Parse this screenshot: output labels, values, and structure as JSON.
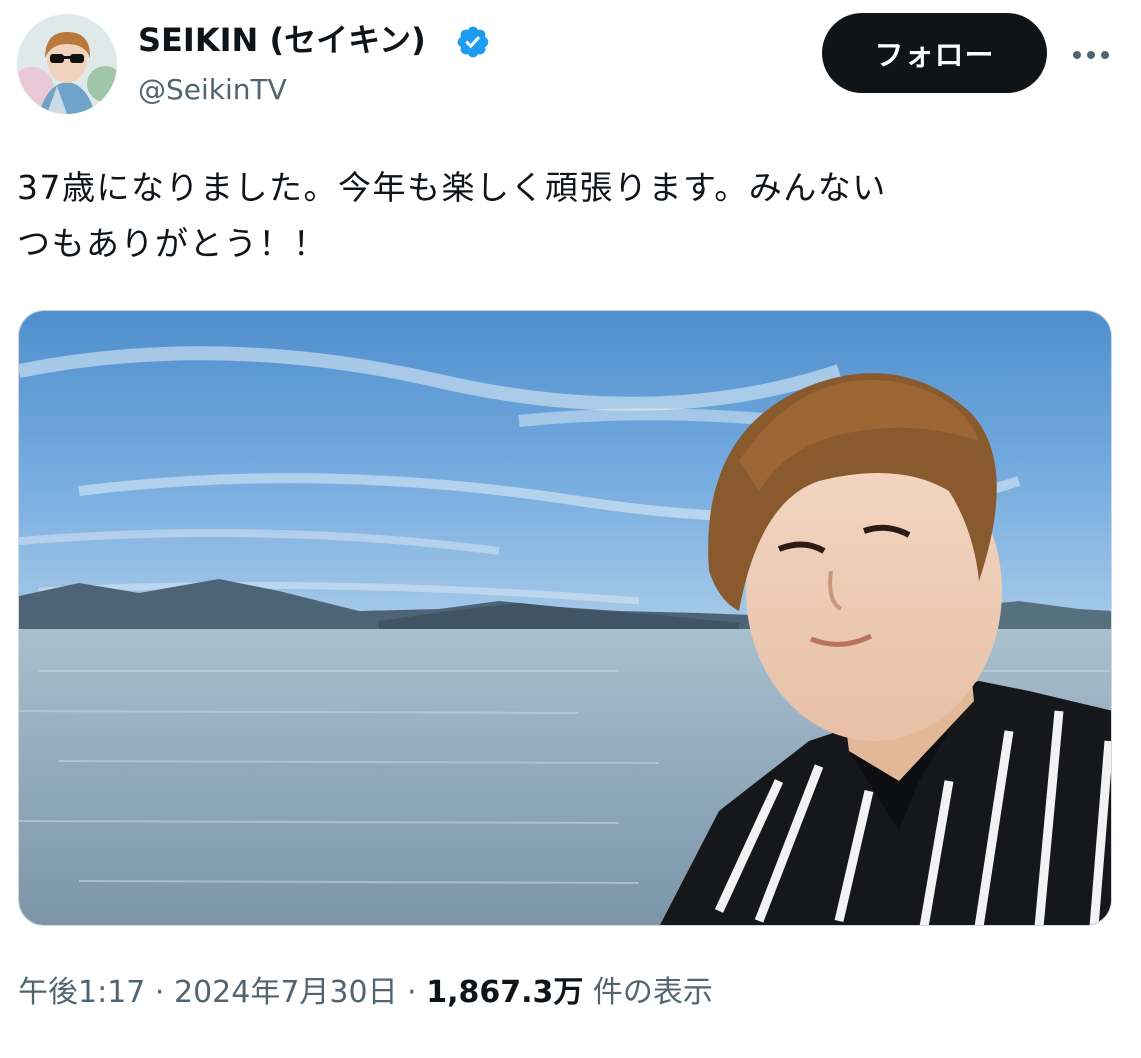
{
  "author": {
    "display_name": "SEIKIN (セイキン)",
    "handle": "@SeikinTV",
    "verified": true
  },
  "follow_label": "フォロー",
  "more_icon": "more-dots-icon",
  "tweet": {
    "text_line1": "37歳になりました。今年も楽しく頑張ります。みんない",
    "text_line2": "つもありがとう！！"
  },
  "meta": {
    "time": "午後1:17",
    "separator": " · ",
    "date": "2024年7月30日",
    "views_count": "1,867.3万",
    "views_label": "件の表示"
  },
  "colors": {
    "text_primary": "#0f1419",
    "text_secondary": "#536471",
    "verified_blue": "#1d9bf0",
    "follow_bg": "#0f1419",
    "border": "#cfd9de"
  }
}
